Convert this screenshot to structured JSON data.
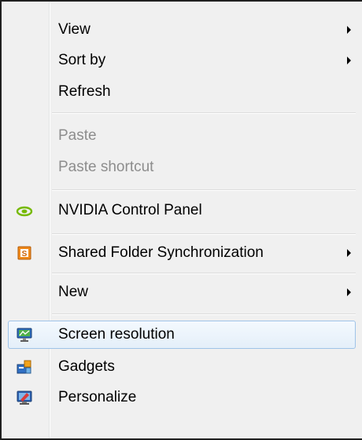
{
  "menu": {
    "view": "View",
    "sort_by": "Sort by",
    "refresh": "Refresh",
    "paste": "Paste",
    "paste_shortcut": "Paste shortcut",
    "nvidia": "NVIDIA Control Panel",
    "shared_folder": "Shared Folder Synchronization",
    "new": "New",
    "screen_resolution": "Screen resolution",
    "gadgets": "Gadgets",
    "personalize": "Personalize"
  },
  "icons": {
    "nvidia": "nvidia-logo-icon",
    "shared_folder": "shared-folder-sync-icon",
    "screen_resolution": "monitor-icon",
    "gadgets": "gadgets-icon",
    "personalize": "personalize-icon"
  },
  "colors": {
    "hover_border": "#9fc3e8",
    "disabled_text": "#8d8d8d",
    "nvidia_green": "#76b900",
    "shared_folder_orange": "#f08a1c"
  }
}
